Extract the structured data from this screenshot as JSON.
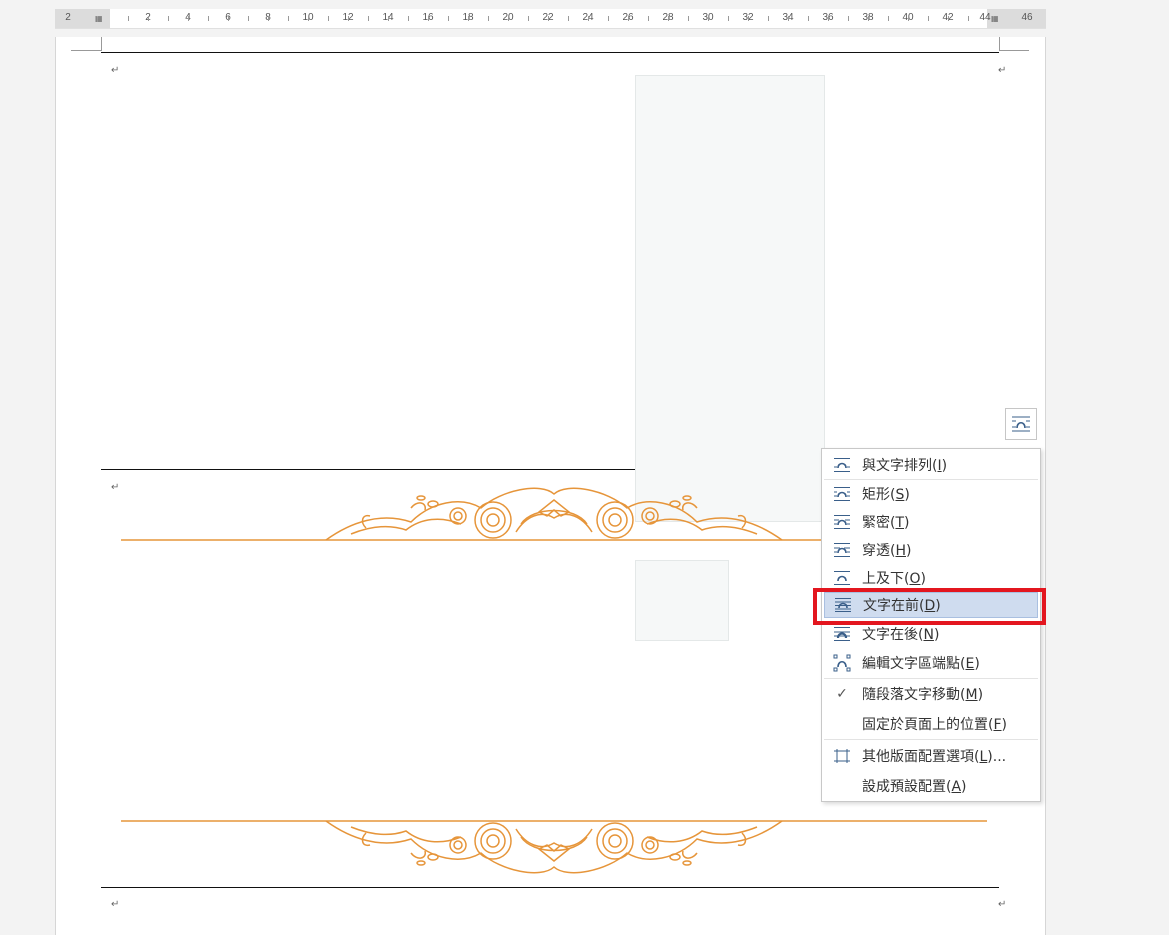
{
  "ruler": {
    "numbers": [
      "2",
      "2",
      "4",
      "6",
      "8",
      "10",
      "12",
      "14",
      "16",
      "18",
      "20",
      "22",
      "24",
      "26",
      "28",
      "30",
      "32",
      "34",
      "36",
      "38",
      "40",
      "42",
      "44",
      "46"
    ]
  },
  "menu": {
    "items": [
      {
        "label": "與文字排列(",
        "key": "I",
        "icon": "wrap-inline-icon"
      },
      {
        "label": "矩形(",
        "key": "S",
        "icon": "wrap-square-icon"
      },
      {
        "label": "緊密(",
        "key": "T",
        "icon": "wrap-tight-icon"
      },
      {
        "label": "穿透(",
        "key": "H",
        "icon": "wrap-through-icon"
      },
      {
        "label": "上及下(",
        "key": "O",
        "icon": "wrap-top-bottom-icon"
      },
      {
        "label": "文字在前(",
        "key": "D",
        "icon": "wrap-in-front-icon"
      },
      {
        "label": "文字在後(",
        "key": "N",
        "icon": "wrap-behind-icon"
      },
      {
        "label": "編輯文字區端點(",
        "key": "E",
        "icon": "edit-wrap-points-icon"
      },
      {
        "label": "隨段落文字移動(",
        "key": "M",
        "icon": "check-icon"
      },
      {
        "label": "固定於頁面上的位置(",
        "key": "F",
        "icon": ""
      },
      {
        "label": "其他版面配置選項(",
        "key": "L",
        "icon": "more-layout-icon",
        "suffix": "..."
      },
      {
        "label": "設成預設配置(",
        "key": "A",
        "icon": ""
      }
    ]
  },
  "colors": {
    "ornament": "#e6953a",
    "highlight": "#cfdcef",
    "callout": "#e3161f"
  }
}
